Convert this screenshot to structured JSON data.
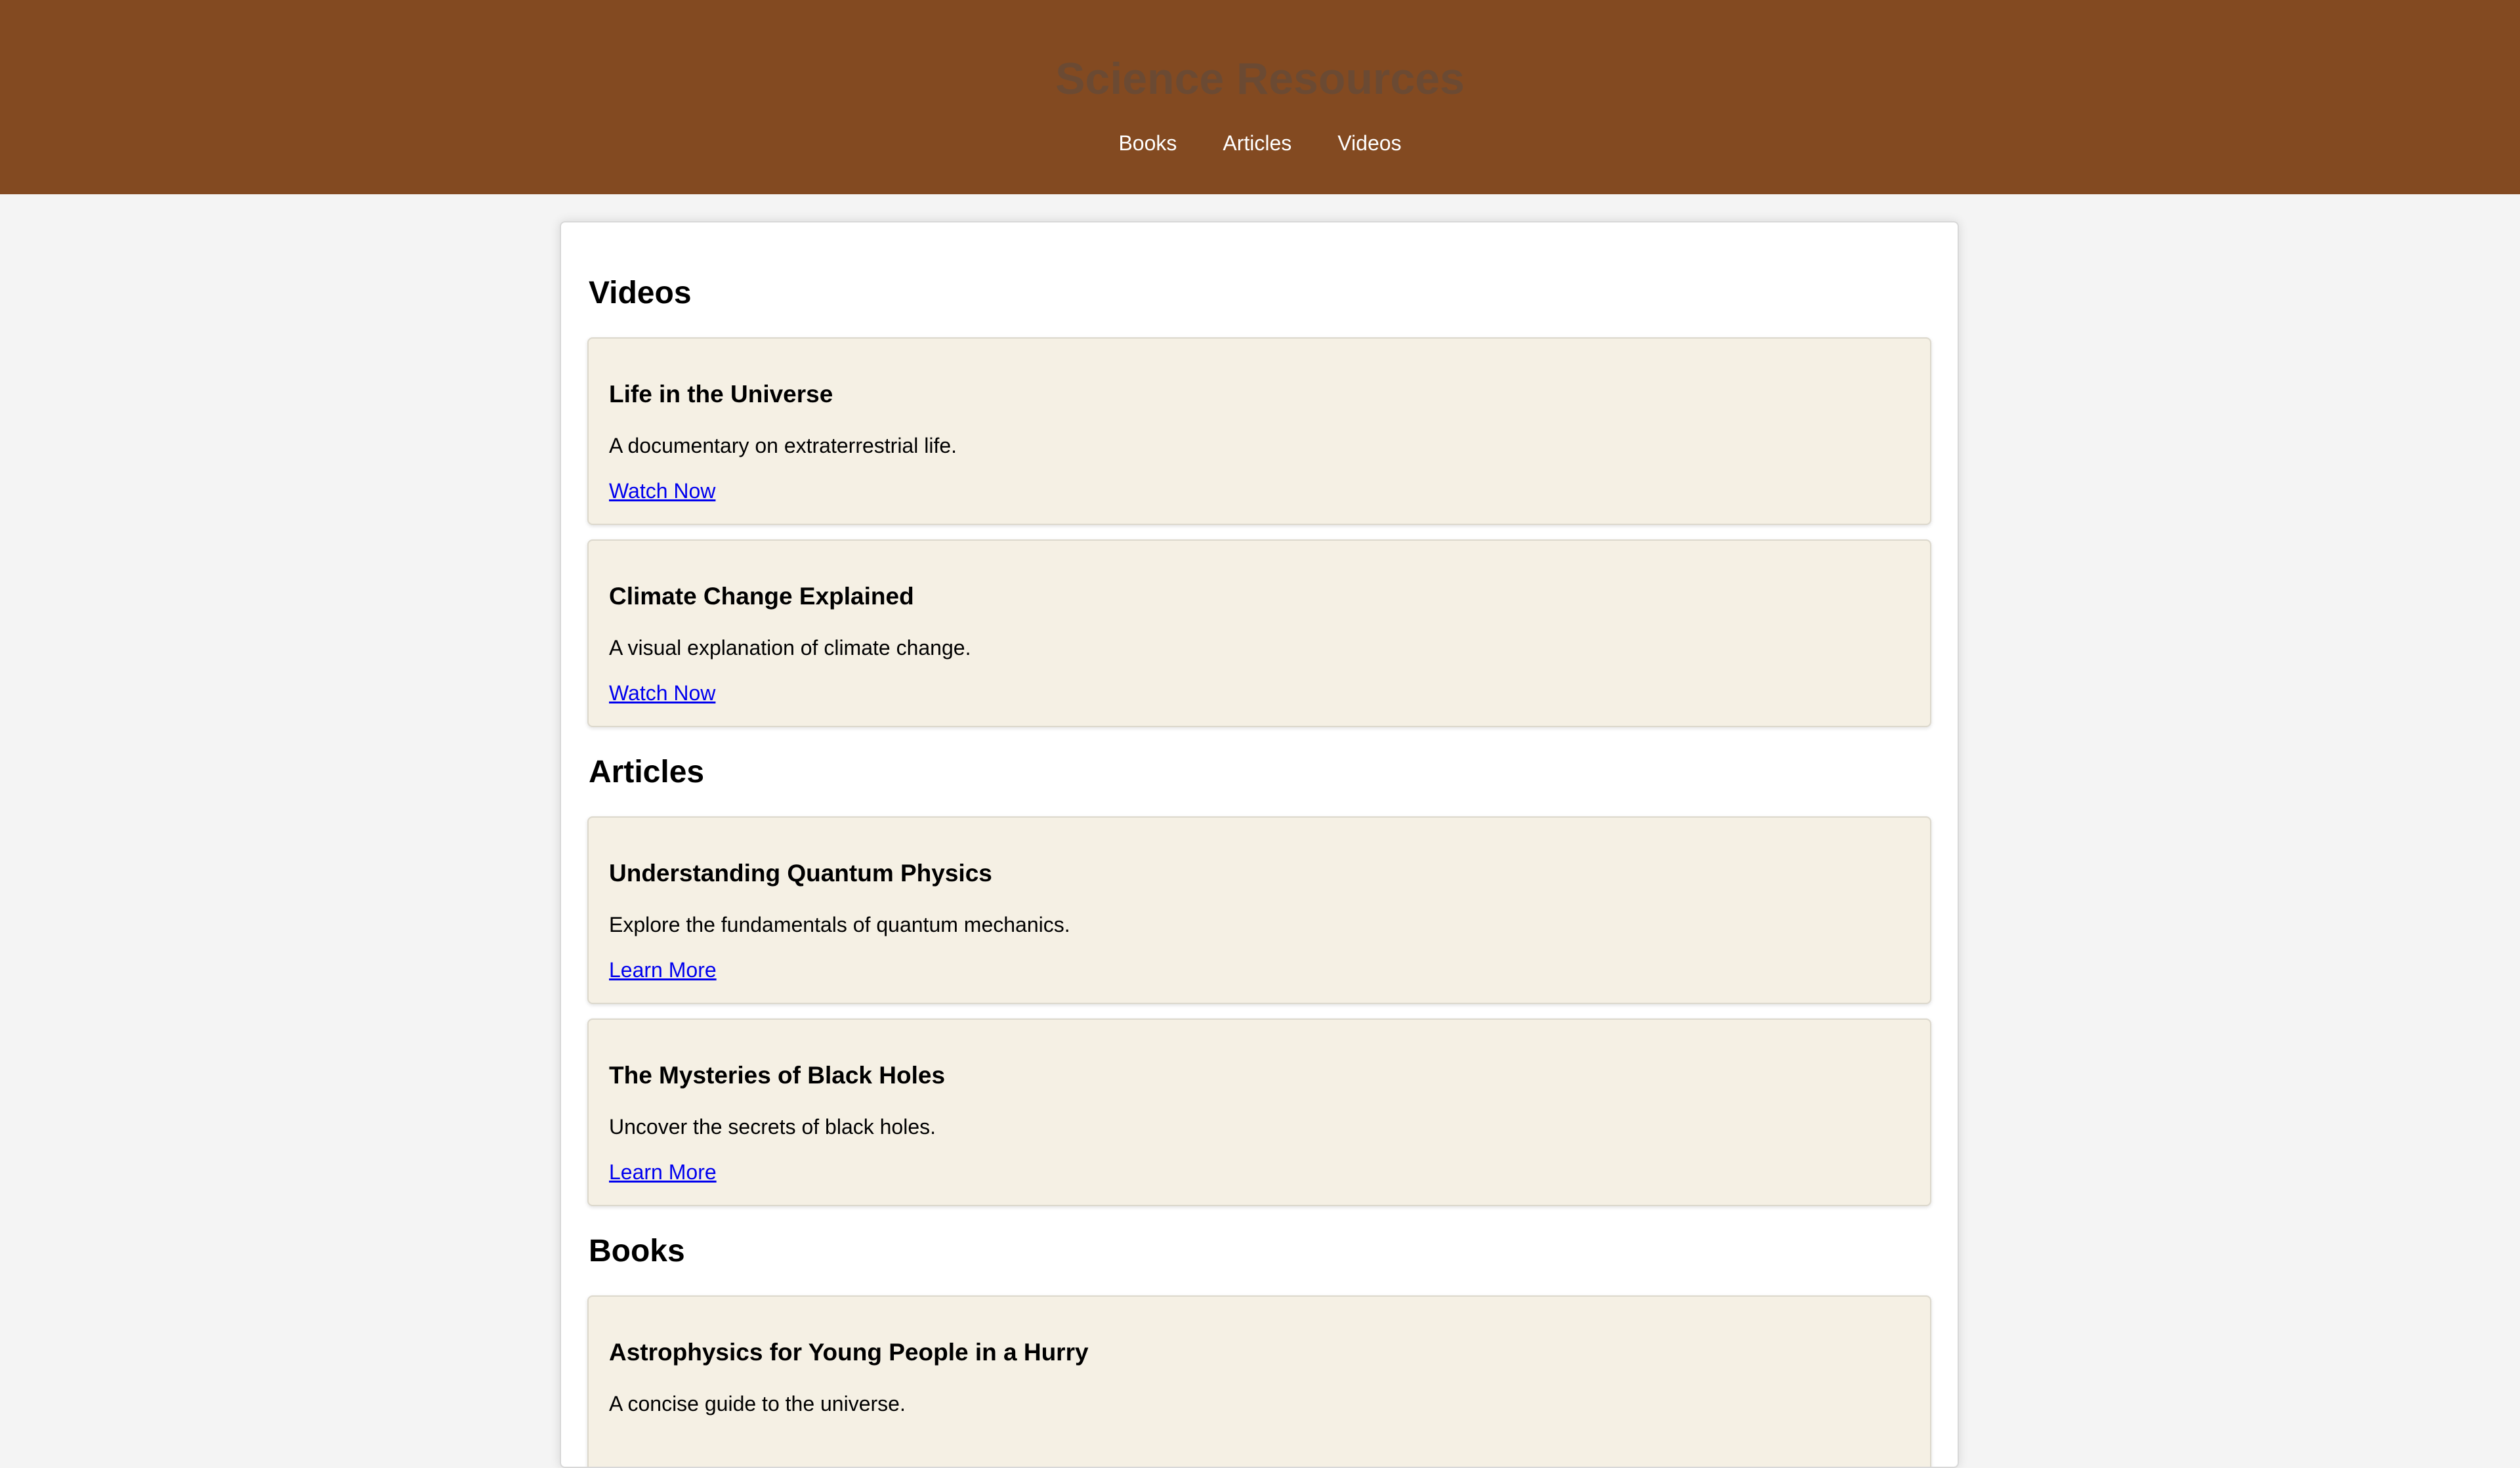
{
  "header": {
    "title": "Science Resources",
    "nav": [
      "Books",
      "Articles",
      "Videos"
    ]
  },
  "sections": [
    {
      "title": "Videos",
      "items": [
        {
          "title": "Life in the Universe",
          "description": "A documentary on extraterrestrial life.",
          "link": "Watch Now"
        },
        {
          "title": "Climate Change Explained",
          "description": "A visual explanation of climate change.",
          "link": "Watch Now"
        }
      ]
    },
    {
      "title": "Articles",
      "items": [
        {
          "title": "Understanding Quantum Physics",
          "description": "Explore the fundamentals of quantum mechanics.",
          "link": "Learn More"
        },
        {
          "title": "The Mysteries of Black Holes",
          "description": "Uncover the secrets of black holes.",
          "link": "Learn More"
        }
      ]
    },
    {
      "title": "Books",
      "items": [
        {
          "title": "Astrophysics for Young People in a Hurry",
          "description": "A concise guide to the universe.",
          "link": ""
        }
      ]
    }
  ]
}
